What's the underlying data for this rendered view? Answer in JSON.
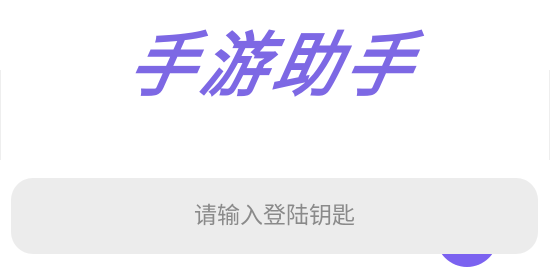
{
  "logo": {
    "text": "手游助手",
    "color": "#7d68e4"
  },
  "login": {
    "key_input": {
      "placeholder": "请输入登陆钥匙",
      "value": ""
    }
  },
  "fab": {
    "color": "#7b62f0"
  }
}
